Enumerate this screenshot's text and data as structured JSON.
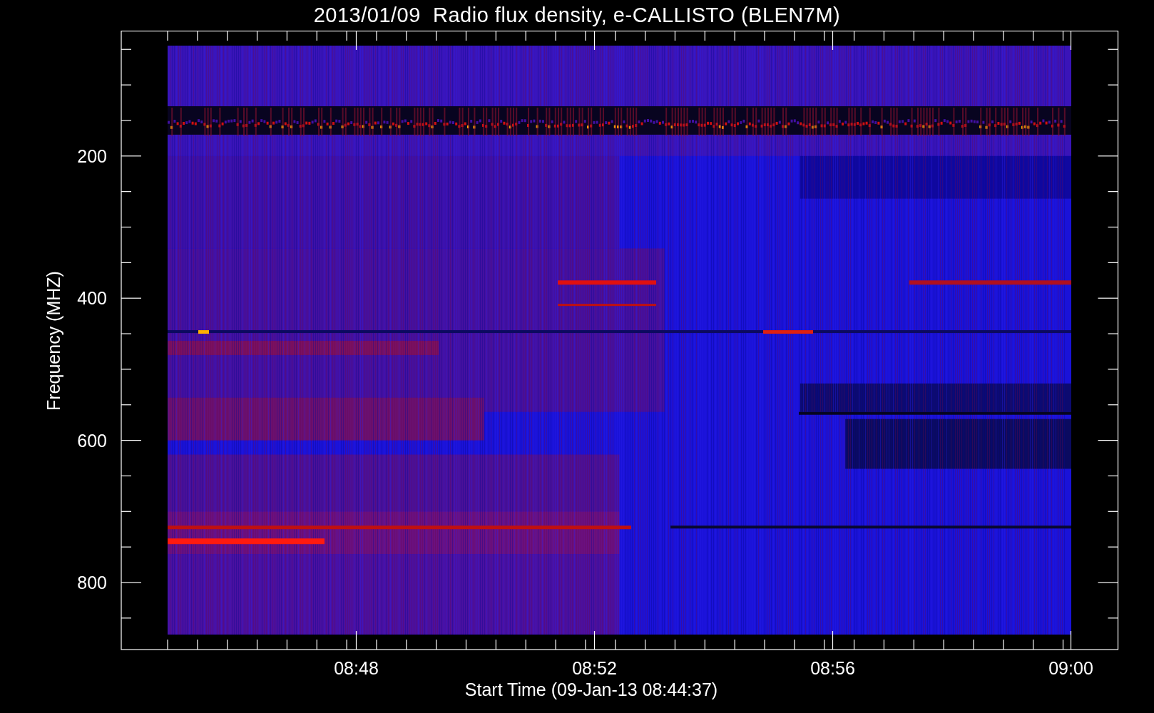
{
  "title": "2013/01/09  Radio flux density, e-CALLISTO (BLEN7M)",
  "y_axis": {
    "label": "Frequency (MHZ)",
    "ticks": [
      "200",
      "400",
      "600",
      "800"
    ]
  },
  "x_axis": {
    "label": "Start Time (09-Jan-13 08:44:37)",
    "ticks": [
      "08:48",
      "08:52",
      "08:56",
      "09:00"
    ]
  }
}
